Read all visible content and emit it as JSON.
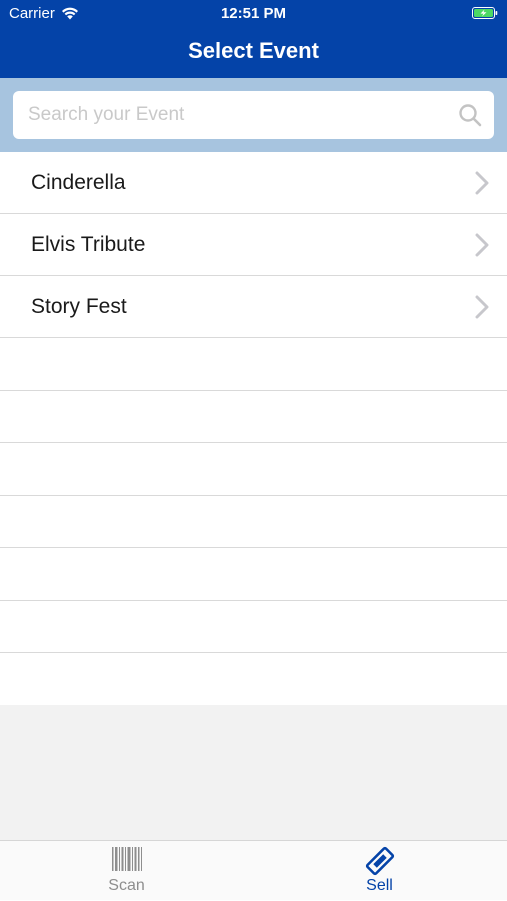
{
  "status_bar": {
    "carrier": "Carrier",
    "time": "12:51 PM"
  },
  "header": {
    "title": "Select Event"
  },
  "search": {
    "placeholder": "Search your Event",
    "value": ""
  },
  "events": [
    {
      "label": "Cinderella"
    },
    {
      "label": "Elvis Tribute"
    },
    {
      "label": "Story Fest"
    }
  ],
  "tabbar": {
    "tabs": [
      {
        "label": "Scan",
        "icon": "barcode-icon",
        "selected": false
      },
      {
        "label": "Sell",
        "icon": "ticket-icon",
        "selected": true
      }
    ]
  },
  "colors": {
    "accent": "#0443a8",
    "search_band": "#a7c4df",
    "battery": "#4cd964"
  }
}
